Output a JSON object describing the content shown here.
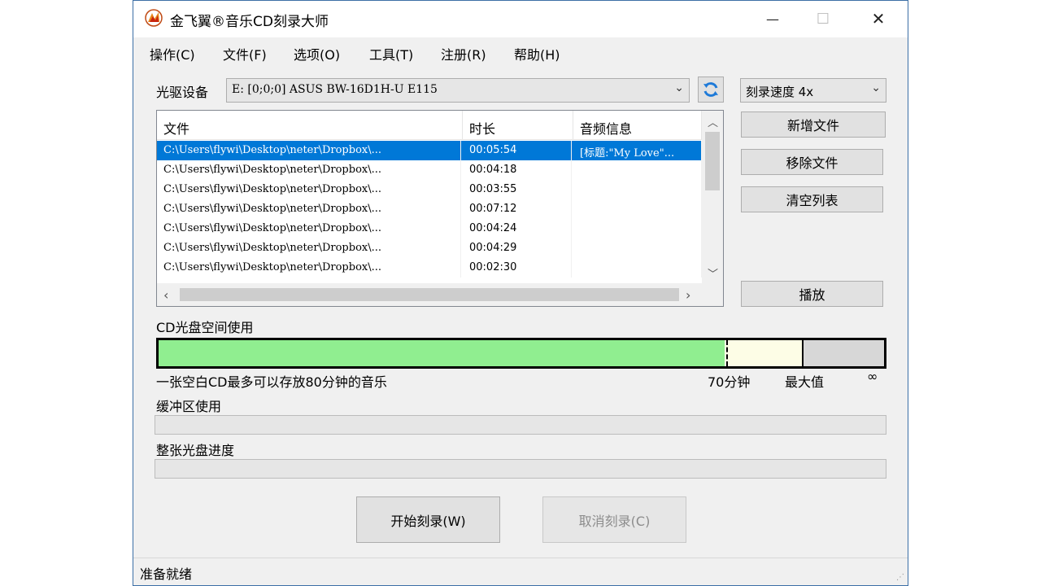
{
  "window": {
    "title": "金飞翼®音乐CD刻录大师",
    "minimize": "—",
    "maximize": "☐",
    "close": "✕"
  },
  "menu": [
    "操作(C)",
    "文件(F)",
    "选项(O)",
    "工具(T)",
    "注册(R)",
    "帮助(H)"
  ],
  "drive": {
    "label": "光驱设备",
    "value": "E:  [0;0;0] ASUS BW-16D1H-U E115"
  },
  "speed": {
    "value": "刻录速度 4x"
  },
  "buttons": {
    "add_file": "新增文件",
    "remove_file": "移除文件",
    "clear_list": "清空列表",
    "play": "播放",
    "start_burn": "开始刻录(W)",
    "cancel_burn": "取消刻录(C)"
  },
  "list": {
    "columns": [
      "文件",
      "时长",
      "音频信息"
    ],
    "rows": [
      {
        "file": "C:\\Users\\flywi\\Desktop\\neter\\Dropbox\\...",
        "duration": "00:05:54",
        "info": "[标题:\"My Love\"...",
        "selected": true
      },
      {
        "file": "C:\\Users\\flywi\\Desktop\\neter\\Dropbox\\...",
        "duration": "00:04:18",
        "info": ""
      },
      {
        "file": "C:\\Users\\flywi\\Desktop\\neter\\Dropbox\\...",
        "duration": "00:03:55",
        "info": ""
      },
      {
        "file": "C:\\Users\\flywi\\Desktop\\neter\\Dropbox\\...",
        "duration": "00:07:12",
        "info": ""
      },
      {
        "file": "C:\\Users\\flywi\\Desktop\\neter\\Dropbox\\...",
        "duration": "00:04:24",
        "info": ""
      },
      {
        "file": "C:\\Users\\flywi\\Desktop\\neter\\Dropbox\\...",
        "duration": "00:04:29",
        "info": ""
      },
      {
        "file": "C:\\Users\\flywi\\Desktop\\neter\\Dropbox\\...",
        "duration": "00:02:30",
        "info": ""
      }
    ]
  },
  "cd_usage": {
    "label": "CD光盘空间使用",
    "used_fraction": 0.78,
    "mark70_fraction": 0.785,
    "max_fraction": 0.887,
    "note": "一张空白CD最多可以存放80分钟的音乐",
    "mark70_label": "70分钟",
    "max_label": "最大值",
    "infinity_label": "∞",
    "colors": {
      "used": "#90ee90",
      "free": "#fdfde6",
      "over": "#d7d7d7"
    }
  },
  "buffer": {
    "label": "缓冲区使用",
    "value": 0
  },
  "disc_progress": {
    "label": "整张光盘进度",
    "value": 0
  },
  "status": {
    "text": "准备就绪"
  }
}
